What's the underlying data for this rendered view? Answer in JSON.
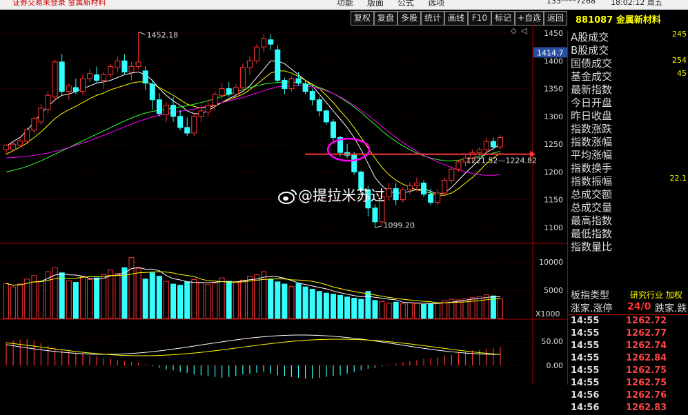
{
  "app": {
    "title": "证券交易未登录  金属新材料"
  },
  "menu": [
    "功能",
    "版面",
    "公式",
    "选项"
  ],
  "account": "135****7268",
  "clock": "18:02:12 周五",
  "toolbar": [
    "复权",
    "复盘",
    "多股",
    "统计",
    "画线",
    "F10",
    "标记",
    "+自选",
    "返回"
  ],
  "stock": {
    "code": "881087",
    "name": "金属新材料"
  },
  "price_axis": [
    "1450",
    "1400",
    "1350",
    "1300",
    "1250",
    "1200",
    "1150",
    "1100"
  ],
  "current_price_tag": "1414.7",
  "volume_axis": [
    "10000",
    "5000"
  ],
  "volume_unit": "X1000",
  "macd_axis": [
    "50.00",
    "0.00"
  ],
  "annotations": {
    "high": "1452.18",
    "low": "1099.20",
    "range": "1221.52—1224.82"
  },
  "chart_data": {
    "type": "candlestick",
    "ylim": [
      1085,
      1460
    ],
    "candles": [
      [
        1240,
        1250,
        1232,
        1248
      ],
      [
        1240,
        1255,
        1238,
        1250
      ],
      [
        1248,
        1260,
        1244,
        1256
      ],
      [
        1255,
        1280,
        1250,
        1276
      ],
      [
        1275,
        1300,
        1270,
        1296
      ],
      [
        1290,
        1322,
        1285,
        1315
      ],
      [
        1313,
        1345,
        1305,
        1338
      ],
      [
        1335,
        1402,
        1330,
        1398
      ],
      [
        1398,
        1412,
        1340,
        1345
      ],
      [
        1345,
        1360,
        1330,
        1355
      ],
      [
        1352,
        1368,
        1340,
        1345
      ],
      [
        1345,
        1375,
        1338,
        1368
      ],
      [
        1368,
        1385,
        1362,
        1377
      ],
      [
        1375,
        1390,
        1360,
        1365
      ],
      [
        1365,
        1380,
        1350,
        1375
      ],
      [
        1375,
        1395,
        1370,
        1390
      ],
      [
        1388,
        1408,
        1380,
        1400
      ],
      [
        1400,
        1412,
        1375,
        1380
      ],
      [
        1380,
        1398,
        1365,
        1390
      ],
      [
        1390,
        1452,
        1385,
        1398
      ],
      [
        1382,
        1390,
        1348,
        1360
      ],
      [
        1358,
        1366,
        1312,
        1330
      ],
      [
        1330,
        1342,
        1300,
        1305
      ],
      [
        1303,
        1325,
        1290,
        1320
      ],
      [
        1320,
        1335,
        1290,
        1300
      ],
      [
        1300,
        1312,
        1275,
        1280
      ],
      [
        1280,
        1298,
        1265,
        1270
      ],
      [
        1270,
        1305,
        1265,
        1300
      ],
      [
        1300,
        1320,
        1290,
        1310
      ],
      [
        1308,
        1330,
        1300,
        1320
      ],
      [
        1320,
        1345,
        1310,
        1340
      ],
      [
        1338,
        1360,
        1330,
        1350
      ],
      [
        1350,
        1362,
        1335,
        1340
      ],
      [
        1340,
        1358,
        1332,
        1352
      ],
      [
        1352,
        1395,
        1348,
        1388
      ],
      [
        1388,
        1408,
        1375,
        1400
      ],
      [
        1400,
        1430,
        1395,
        1425
      ],
      [
        1425,
        1448,
        1415,
        1440
      ],
      [
        1438,
        1448,
        1420,
        1430
      ],
      [
        1420,
        1428,
        1360,
        1365
      ],
      [
        1365,
        1370,
        1340,
        1350
      ],
      [
        1350,
        1372,
        1345,
        1368
      ],
      [
        1368,
        1380,
        1355,
        1360
      ],
      [
        1358,
        1365,
        1340,
        1345
      ],
      [
        1345,
        1350,
        1320,
        1330
      ],
      [
        1330,
        1335,
        1300,
        1310
      ],
      [
        1310,
        1312,
        1285,
        1290
      ],
      [
        1290,
        1295,
        1255,
        1262
      ],
      [
        1262,
        1265,
        1228,
        1235
      ],
      [
        1235,
        1250,
        1225,
        1230
      ],
      [
        1230,
        1236,
        1195,
        1200
      ],
      [
        1200,
        1202,
        1160,
        1168
      ],
      [
        1168,
        1175,
        1120,
        1135
      ],
      [
        1135,
        1142,
        1100,
        1110
      ],
      [
        1110,
        1165,
        1105,
        1155
      ],
      [
        1155,
        1180,
        1148,
        1170
      ],
      [
        1170,
        1180,
        1140,
        1150
      ],
      [
        1150,
        1172,
        1145,
        1168
      ],
      [
        1168,
        1182,
        1160,
        1175
      ],
      [
        1175,
        1190,
        1165,
        1180
      ],
      [
        1180,
        1185,
        1155,
        1160
      ],
      [
        1160,
        1170,
        1140,
        1145
      ],
      [
        1145,
        1168,
        1140,
        1162
      ],
      [
        1162,
        1190,
        1158,
        1185
      ],
      [
        1185,
        1210,
        1180,
        1205
      ],
      [
        1205,
        1222,
        1200,
        1218
      ],
      [
        1218,
        1230,
        1210,
        1225
      ],
      [
        1225,
        1240,
        1218,
        1235
      ],
      [
        1235,
        1245,
        1225,
        1240
      ],
      [
        1240,
        1262,
        1235,
        1255
      ],
      [
        1255,
        1262,
        1240,
        1245
      ],
      [
        1245,
        1266,
        1240,
        1262
      ]
    ],
    "ma_white": [
      1246,
      1255,
      1262,
      1275,
      1290,
      1305,
      1318,
      1330,
      1338,
      1340,
      1345,
      1350,
      1355,
      1360,
      1362,
      1365,
      1370,
      1375,
      1378,
      1380,
      1375,
      1365,
      1350,
      1338,
      1328,
      1320,
      1310,
      1305,
      1305,
      1310,
      1318,
      1325,
      1332,
      1338,
      1345,
      1355,
      1370,
      1385,
      1400,
      1400,
      1395,
      1385,
      1375,
      1365,
      1355,
      1340,
      1325,
      1310,
      1295,
      1280,
      1262,
      1240,
      1215,
      1190,
      1175,
      1165,
      1162,
      1162,
      1165,
      1168,
      1170,
      1165,
      1160,
      1162,
      1172,
      1185,
      1198,
      1210,
      1222,
      1235,
      1242,
      1250
    ],
    "ma_yellow": [
      1232,
      1238,
      1245,
      1252,
      1262,
      1272,
      1284,
      1296,
      1305,
      1312,
      1318,
      1325,
      1332,
      1338,
      1342,
      1348,
      1352,
      1356,
      1360,
      1362,
      1362,
      1358,
      1352,
      1345,
      1338,
      1330,
      1322,
      1318,
      1315,
      1316,
      1320,
      1325,
      1330,
      1335,
      1340,
      1348,
      1358,
      1368,
      1378,
      1382,
      1382,
      1378,
      1372,
      1365,
      1358,
      1350,
      1338,
      1325,
      1310,
      1296,
      1280,
      1262,
      1243,
      1225,
      1208,
      1195,
      1185,
      1178,
      1172,
      1168,
      1165,
      1162,
      1158,
      1158,
      1162,
      1170,
      1180,
      1190,
      1202,
      1215,
      1225,
      1234
    ],
    "ma_green": [
      1200,
      1203,
      1206,
      1210,
      1215,
      1220,
      1226,
      1232,
      1238,
      1244,
      1250,
      1256,
      1262,
      1268,
      1274,
      1280,
      1286,
      1292,
      1297,
      1302,
      1306,
      1309,
      1311,
      1313,
      1315,
      1317,
      1319,
      1322,
      1325,
      1328,
      1332,
      1336,
      1340,
      1344,
      1348,
      1352,
      1355,
      1358,
      1360,
      1361,
      1362,
      1362,
      1361,
      1359,
      1356,
      1352,
      1347,
      1341,
      1334,
      1326,
      1317,
      1307,
      1296,
      1285,
      1274,
      1264,
      1255,
      1247,
      1240,
      1234,
      1229,
      1225,
      1222,
      1220,
      1220,
      1221,
      1223,
      1225,
      1228,
      1231,
      1234,
      1237
    ],
    "ma_magenta": [
      1225,
      1226,
      1227,
      1228,
      1230,
      1232,
      1234,
      1237,
      1240,
      1244,
      1248,
      1252,
      1256,
      1261,
      1266,
      1271,
      1276,
      1281,
      1286,
      1291,
      1295,
      1299,
      1302,
      1305,
      1307,
      1309,
      1311,
      1313,
      1316,
      1319,
      1322,
      1325,
      1328,
      1331,
      1334,
      1338,
      1342,
      1346,
      1350,
      1353,
      1355,
      1356,
      1356,
      1355,
      1353,
      1350,
      1346,
      1341,
      1335,
      1328,
      1320,
      1311,
      1302,
      1292,
      1282,
      1272,
      1262,
      1253,
      1245,
      1237,
      1230,
      1224,
      1218,
      1213,
      1208,
      1204,
      1200,
      1197,
      1195,
      1194,
      1194,
      1195
    ],
    "volume": [
      6200,
      5600,
      6100,
      7000,
      7600,
      6600,
      8300,
      9000,
      8100,
      6700,
      6400,
      7400,
      6900,
      7200,
      7800,
      8600,
      8000,
      9000,
      10800,
      8900,
      7000,
      8100,
      7500,
      6600,
      6100,
      5900,
      6500,
      6900,
      6400,
      6000,
      6300,
      7200,
      6600,
      6400,
      6800,
      7400,
      7800,
      8300,
      7000,
      6500,
      6100,
      5700,
      6200,
      5600,
      5200,
      4800,
      4500,
      4300,
      4100,
      3800,
      3600,
      3400,
      4800,
      3200,
      3000,
      2700,
      2900,
      2600,
      2800,
      2700,
      2500,
      2600,
      2800,
      3200,
      3400,
      3300,
      3500,
      3700,
      3900,
      4200,
      4000,
      3500
    ],
    "macd": [
      28,
      30,
      31,
      32,
      30,
      27,
      24,
      21,
      19,
      17,
      15,
      14,
      12,
      11,
      9,
      8,
      6,
      5,
      4,
      3,
      1,
      -1,
      -3,
      -5,
      -6,
      -8,
      -9,
      -11,
      -12,
      -13,
      -14,
      -15,
      -14,
      -13,
      -11,
      -10,
      -9,
      -8,
      -10,
      -12,
      -13,
      -14,
      -15,
      -16,
      -16,
      -15,
      -14,
      -13,
      -12,
      -10,
      -8,
      -6,
      -4,
      -3,
      -1,
      1,
      2,
      4,
      5,
      6,
      8,
      9,
      10,
      12,
      13,
      15,
      16,
      18,
      19,
      20,
      21,
      22
    ]
  },
  "panel": {
    "rows": [
      {
        "label": "A股成交",
        "value": "245"
      },
      {
        "label": "B股成交",
        "value": ""
      },
      {
        "label": "国债成交",
        "value": "254"
      },
      {
        "label": "基金成交",
        "value": "45"
      },
      {
        "label": "最新指数",
        "value": ""
      },
      {
        "label": "今日开盘",
        "value": ""
      },
      {
        "label": "昨日收盘",
        "value": ""
      },
      {
        "label": "指数涨跌",
        "value": ""
      },
      {
        "label": "指数涨幅",
        "value": ""
      },
      {
        "label": "平均涨幅",
        "value": ""
      },
      {
        "label": "指数换手",
        "value": ""
      },
      {
        "label": "指数振幅",
        "value": "22.1"
      },
      {
        "label": "总成交额",
        "value": ""
      },
      {
        "label": "总成交量",
        "value": ""
      },
      {
        "label": "最高指数",
        "value": ""
      },
      {
        "label": "最低指数",
        "value": ""
      },
      {
        "label": "指数量比",
        "value": ""
      }
    ],
    "sector_label": "板指类型",
    "sector_type": "研究行业 加权",
    "adv_label": "涨家.涨停",
    "adv_value": "24/0",
    "dec_label": "跌家.跌",
    "ticks": [
      {
        "time": "14:55",
        "price": "1262.72"
      },
      {
        "time": "14:55",
        "price": "1262.77"
      },
      {
        "time": "14:55",
        "price": "1262.74"
      },
      {
        "time": "14:55",
        "price": "1262.84"
      },
      {
        "time": "14:55",
        "price": "1262.75"
      },
      {
        "time": "14:55",
        "price": "1262.75"
      },
      {
        "time": "14:56",
        "price": "1262.76"
      },
      {
        "time": "14:56",
        "price": "1262.83"
      }
    ]
  },
  "watermark": "@提拉米苏过"
}
